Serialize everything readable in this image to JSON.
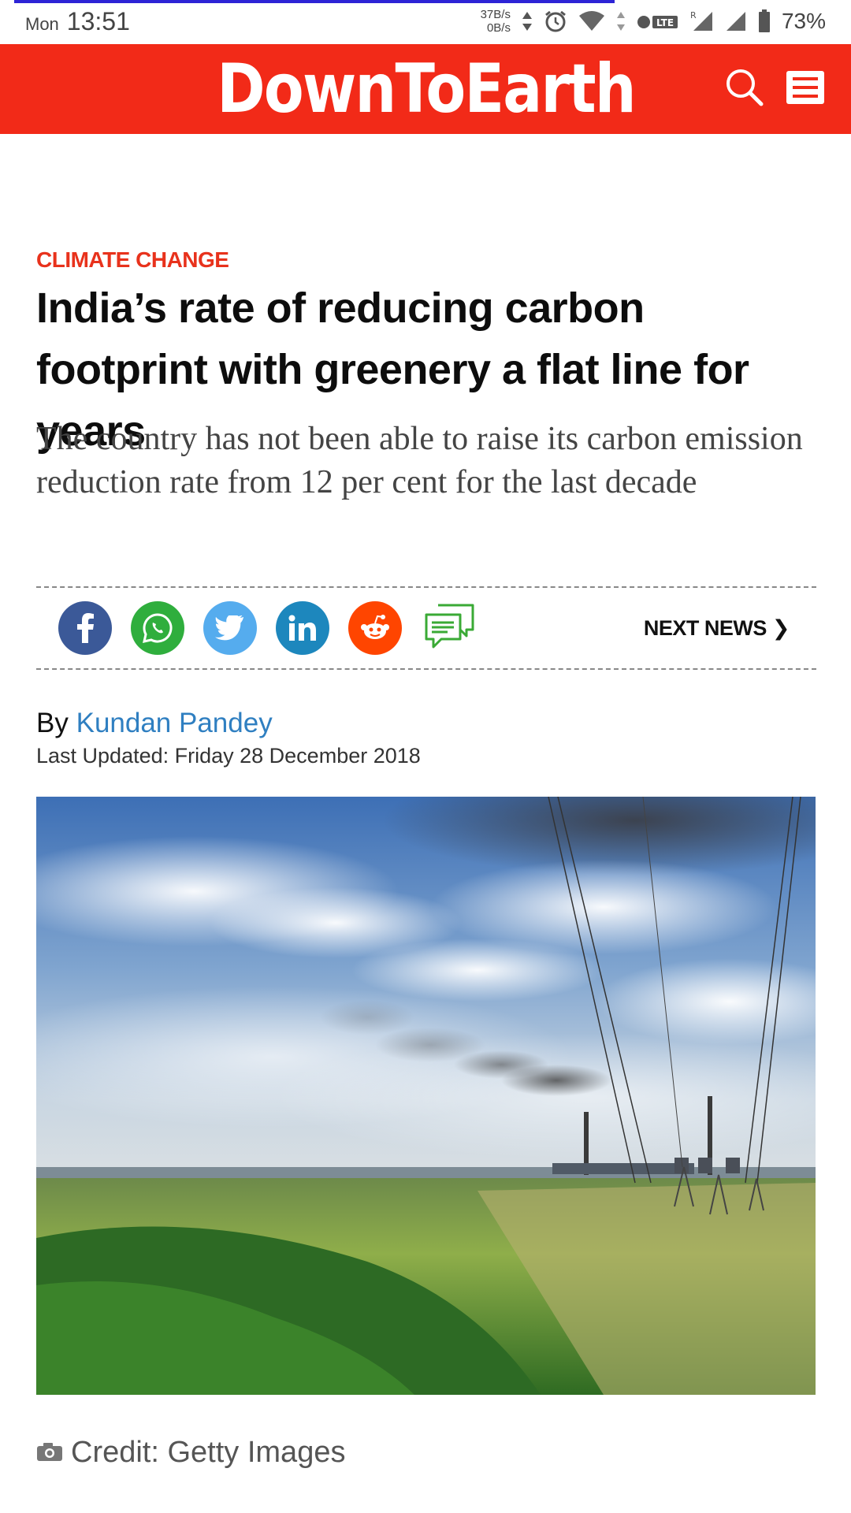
{
  "status_bar": {
    "day": "Mon",
    "time": "13:51",
    "speed_up": "37B/s",
    "speed_down": "0B/s",
    "battery": "73%",
    "icons": [
      "arrows-icon",
      "alarm-icon",
      "wifi-icon",
      "data-icon",
      "lte-icon",
      "signal-icon",
      "signal-icon",
      "battery-icon"
    ]
  },
  "header": {
    "logo": "DownToEarth",
    "brand_color": "#f22a18"
  },
  "article": {
    "category": "CLIMATE CHANGE",
    "headline": "India’s rate of reducing carbon footprint with greenery a flat line for years",
    "subheading": "The country has not been able to raise its carbon emission reduction rate from 12 per cent for the last decade",
    "share": {
      "buttons": [
        "facebook",
        "whatsapp",
        "twitter",
        "linkedin",
        "reddit",
        "comments"
      ],
      "next_news": "NEXT NEWS ❯"
    },
    "byline_prefix": "By",
    "author": "Kundan Pandey",
    "last_updated": "Last Updated: Friday 28 December 2018",
    "image_credit": "Credit: Getty Images"
  }
}
